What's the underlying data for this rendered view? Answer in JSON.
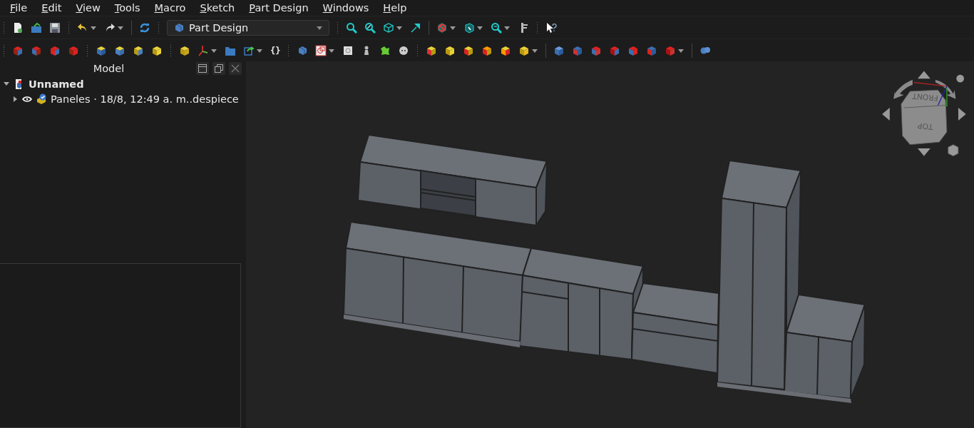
{
  "menu_bar": [
    "File",
    "Edit",
    "View",
    "Tools",
    "Macro",
    "Sketch",
    "Part Design",
    "Windows",
    "Help"
  ],
  "workbench_selector": {
    "value": "Part Design"
  },
  "toolbar_text_buttons": [
    "{}"
  ],
  "model_panel": {
    "title": "Model",
    "tree": [
      {
        "label": "Unnamed",
        "expanded": true,
        "children": [
          {
            "label": "Paneles · 18/8, 12:49 a. m..despiece",
            "expanded": false,
            "visible": true
          }
        ]
      }
    ]
  },
  "nav_cube": {
    "faces": [
      "FRONT",
      "TOP"
    ]
  }
}
